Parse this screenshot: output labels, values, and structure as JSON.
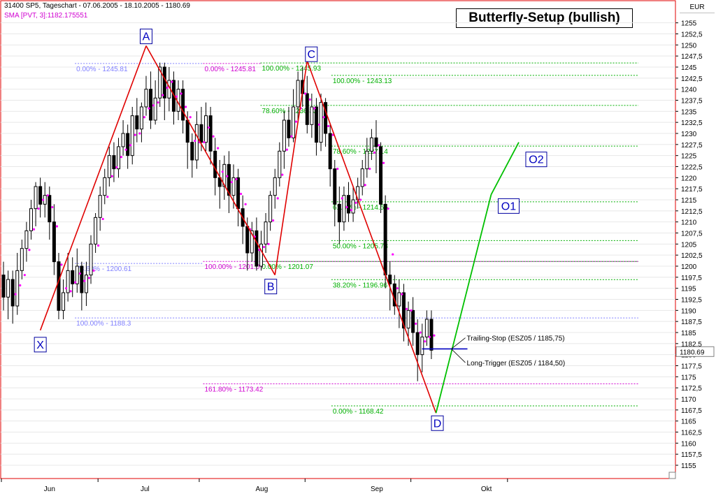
{
  "header": {
    "instrument": "31400  SP5, Tageschart - 07.06.2005 - 18.10.2005 - 1180.69",
    "sma": "SMA [PVT, 3]:1182.175551",
    "currency": "EUR"
  },
  "title": "Butterfly-Setup (bullish)",
  "colors": {
    "pattern": "#e00000",
    "projection": "#00c000",
    "fib_blue": "#8080ff",
    "fib_magenta": "#d000d0",
    "fib_green": "#00b000",
    "candle": "#000000",
    "sma": "#ff00ff",
    "border": "#e00000"
  },
  "chart_data": {
    "type": "candlestick",
    "ylim": [
      1152,
      1260
    ],
    "y_ticks": [
      1155,
      1157.5,
      1160,
      1162.5,
      1165,
      1167.5,
      1170,
      1172.5,
      1175,
      1177.5,
      1180,
      1182.5,
      1185,
      1187.5,
      1190,
      1192.5,
      1195,
      1197.5,
      1200,
      1202.5,
      1205,
      1207.5,
      1210,
      1212.5,
      1215,
      1217.5,
      1220,
      1222.5,
      1225,
      1227.5,
      1230,
      1232.5,
      1235,
      1237.5,
      1240,
      1242.5,
      1245,
      1247.5,
      1250,
      1252.5,
      1255
    ],
    "months": [
      "Jun",
      "Jul",
      "Aug",
      "Sep",
      "Okt"
    ],
    "last_price": "1180.69",
    "candles": [
      [
        1198,
        1193,
        1201,
        1190
      ],
      [
        1193,
        1197,
        1199,
        1188
      ],
      [
        1197,
        1191,
        1199,
        1187
      ],
      [
        1191,
        1199,
        1203,
        1189
      ],
      [
        1199,
        1204,
        1206,
        1197
      ],
      [
        1204,
        1208,
        1210,
        1201
      ],
      [
        1208,
        1213,
        1215,
        1206
      ],
      [
        1213,
        1218,
        1219,
        1209
      ],
      [
        1218,
        1214,
        1220,
        1211
      ],
      [
        1214,
        1216,
        1219,
        1211
      ],
      [
        1216,
        1210,
        1218,
        1206
      ],
      [
        1210,
        1201,
        1214,
        1198
      ],
      [
        1201,
        1190,
        1203,
        1188
      ],
      [
        1190,
        1194,
        1197,
        1188
      ],
      [
        1194,
        1199,
        1203,
        1192
      ],
      [
        1199,
        1196,
        1202,
        1193
      ],
      [
        1196,
        1200,
        1204,
        1194
      ],
      [
        1200,
        1194,
        1201,
        1190
      ],
      [
        1194,
        1198,
        1201,
        1191
      ],
      [
        1198,
        1205,
        1207,
        1196
      ],
      [
        1205,
        1211,
        1212,
        1203
      ],
      [
        1211,
        1216,
        1218,
        1208
      ],
      [
        1216,
        1220,
        1222,
        1214
      ],
      [
        1220,
        1225,
        1227,
        1218
      ],
      [
        1225,
        1222,
        1228,
        1219
      ],
      [
        1222,
        1227,
        1229,
        1220
      ],
      [
        1227,
        1230,
        1233,
        1225
      ],
      [
        1230,
        1225,
        1232,
        1222
      ],
      [
        1225,
        1234,
        1236,
        1223
      ],
      [
        1234,
        1231,
        1238,
        1228
      ],
      [
        1231,
        1236,
        1237,
        1228
      ],
      [
        1236,
        1240,
        1243,
        1234
      ],
      [
        1240,
        1233,
        1244,
        1231
      ],
      [
        1233,
        1238,
        1242,
        1232
      ],
      [
        1238,
        1245,
        1246,
        1236
      ],
      [
        1245,
        1238,
        1246,
        1233
      ],
      [
        1238,
        1242,
        1245,
        1235
      ],
      [
        1242,
        1235,
        1244,
        1232
      ],
      [
        1235,
        1240,
        1242,
        1233
      ],
      [
        1240,
        1233,
        1242,
        1230
      ],
      [
        1233,
        1228,
        1235,
        1222
      ],
      [
        1228,
        1224,
        1230,
        1220
      ],
      [
        1224,
        1232,
        1235,
        1222
      ],
      [
        1232,
        1228,
        1236,
        1226
      ],
      [
        1228,
        1234,
        1237,
        1226
      ],
      [
        1234,
        1226,
        1236,
        1223
      ],
      [
        1226,
        1220,
        1229,
        1216
      ],
      [
        1220,
        1218,
        1224,
        1213
      ],
      [
        1218,
        1223,
        1225,
        1215
      ],
      [
        1223,
        1216,
        1226,
        1212
      ],
      [
        1216,
        1220,
        1223,
        1213
      ],
      [
        1220,
        1213,
        1222,
        1209
      ],
      [
        1213,
        1209,
        1216,
        1205
      ],
      [
        1209,
        1203,
        1211,
        1199
      ],
      [
        1203,
        1208,
        1210,
        1201
      ],
      [
        1208,
        1200,
        1211,
        1199
      ],
      [
        1200,
        1205,
        1208,
        1199
      ],
      [
        1205,
        1210,
        1212,
        1203
      ],
      [
        1210,
        1216,
        1217,
        1208
      ],
      [
        1216,
        1220,
        1222,
        1213
      ],
      [
        1220,
        1226,
        1228,
        1218
      ],
      [
        1226,
        1233,
        1235,
        1222
      ],
      [
        1233,
        1229,
        1236,
        1227
      ],
      [
        1229,
        1236,
        1240,
        1228
      ],
      [
        1236,
        1242,
        1244,
        1233
      ],
      [
        1242,
        1239,
        1245,
        1236
      ],
      [
        1239,
        1232,
        1243,
        1230
      ],
      [
        1232,
        1236,
        1239,
        1229
      ],
      [
        1236,
        1228,
        1238,
        1225
      ],
      [
        1228,
        1237,
        1239,
        1226
      ],
      [
        1237,
        1230,
        1238,
        1227
      ],
      [
        1230,
        1222,
        1232,
        1218
      ],
      [
        1222,
        1214,
        1224,
        1209
      ],
      [
        1214,
        1210,
        1218,
        1205
      ],
      [
        1210,
        1216,
        1218,
        1208
      ],
      [
        1216,
        1212,
        1219,
        1210
      ],
      [
        1212,
        1215,
        1218,
        1210
      ],
      [
        1215,
        1218,
        1220,
        1213
      ],
      [
        1218,
        1222,
        1224,
        1216
      ],
      [
        1222,
        1226,
        1229,
        1220
      ],
      [
        1226,
        1229,
        1231,
        1224
      ],
      [
        1229,
        1227,
        1233,
        1221
      ],
      [
        1227,
        1214,
        1228,
        1212
      ],
      [
        1214,
        1198,
        1216,
        1195
      ],
      [
        1198,
        1196,
        1201,
        1190
      ],
      [
        1196,
        1191,
        1198,
        1189
      ],
      [
        1191,
        1194,
        1197,
        1186
      ],
      [
        1194,
        1186,
        1196,
        1183
      ],
      [
        1186,
        1190,
        1192,
        1182
      ],
      [
        1190,
        1185,
        1193,
        1182
      ],
      [
        1185,
        1180,
        1188,
        1174
      ],
      [
        1180,
        1184,
        1187,
        1176
      ],
      [
        1184,
        1188,
        1190,
        1182
      ],
      [
        1188,
        1181,
        1190,
        1179
      ]
    ],
    "pattern_points": [
      {
        "label": "X",
        "idx": 8,
        "price": 1185.5
      },
      {
        "label": "A",
        "idx": 31,
        "price": 1249.8
      },
      {
        "label": "B",
        "idx": 59,
        "price": 1198
      },
      {
        "label": "C",
        "idx": 66,
        "price": 1246.4
      },
      {
        "label": "D",
        "idx": 94,
        "price": 1166.8
      },
      {
        "label": "O1",
        "idx": 106,
        "price": 1216.2
      },
      {
        "label": "O2",
        "idx": 112,
        "price": 1228
      }
    ],
    "levels": [
      {
        "price": 1245.81,
        "label": "0.00% - 1245.81",
        "color": "fib_blue",
        "x1": 0.11,
        "x2": 0.3
      },
      {
        "price": 1245.81,
        "label": "0.00% - 1245.81",
        "color": "fib_magenta",
        "x1": 0.3,
        "x2": 0.385
      },
      {
        "price": 1245.93,
        "label": "100.00% - 1245.93",
        "color": "fib_green",
        "x1": 0.385,
        "x2": 0.945
      },
      {
        "price": 1243.13,
        "label": "100.00% - 1243.13",
        "color": "fib_green",
        "x1": 0.49,
        "x2": 0.945
      },
      {
        "price": 1236.33,
        "label": "78.60% - 1236.33",
        "color": "fib_green",
        "x1": 0.385,
        "x2": 0.945
      },
      {
        "price": 1227.14,
        "label": "78.60% - 1227.14",
        "color": "fib_green",
        "x1": 0.49,
        "x2": 0.945
      },
      {
        "price": 1214.55,
        "label": "61.80% - 1214.55",
        "color": "fib_green",
        "x1": 0.49,
        "x2": 0.945
      },
      {
        "price": 1205.78,
        "label": "50.00% - 1205.78",
        "color": "fib_green",
        "x1": 0.49,
        "x2": 0.945
      },
      {
        "price": 1201.07,
        "label": "100.00% - 1201.07",
        "color": "fib_magenta",
        "x1": 0.3,
        "x2": 0.945
      },
      {
        "price": 1201.07,
        "label": "0.00% - 1201.07",
        "color": "fib_green",
        "x1": 0.385,
        "x2": 0.945
      },
      {
        "price": 1200.61,
        "label": "78.60% - 1200.61",
        "color": "fib_blue",
        "x1": 0.11,
        "x2": 0.3
      },
      {
        "price": 1196.96,
        "label": "38.20% - 1196.96",
        "color": "fib_green",
        "x1": 0.49,
        "x2": 0.945
      },
      {
        "price": 1188.3,
        "label": "100.00% - 1188.3",
        "color": "fib_blue",
        "x1": 0.11,
        "x2": 0.945
      },
      {
        "price": 1173.42,
        "label": "161.80% - 1173.42",
        "color": "fib_magenta",
        "x1": 0.3,
        "x2": 0.945
      },
      {
        "price": 1168.42,
        "label": "0.00% - 1168.42",
        "color": "fib_green",
        "x1": 0.49,
        "x2": 0.945
      }
    ],
    "trade_lines": [
      {
        "label": "Trailing-Stop (ESZ05 / 1185,75)",
        "price": 1181.3,
        "label_price": 1183.8
      },
      {
        "label": "Long-Trigger (ESZ05 / 1184,50)",
        "price": 1181.3,
        "label_price": 1178.2
      }
    ]
  }
}
